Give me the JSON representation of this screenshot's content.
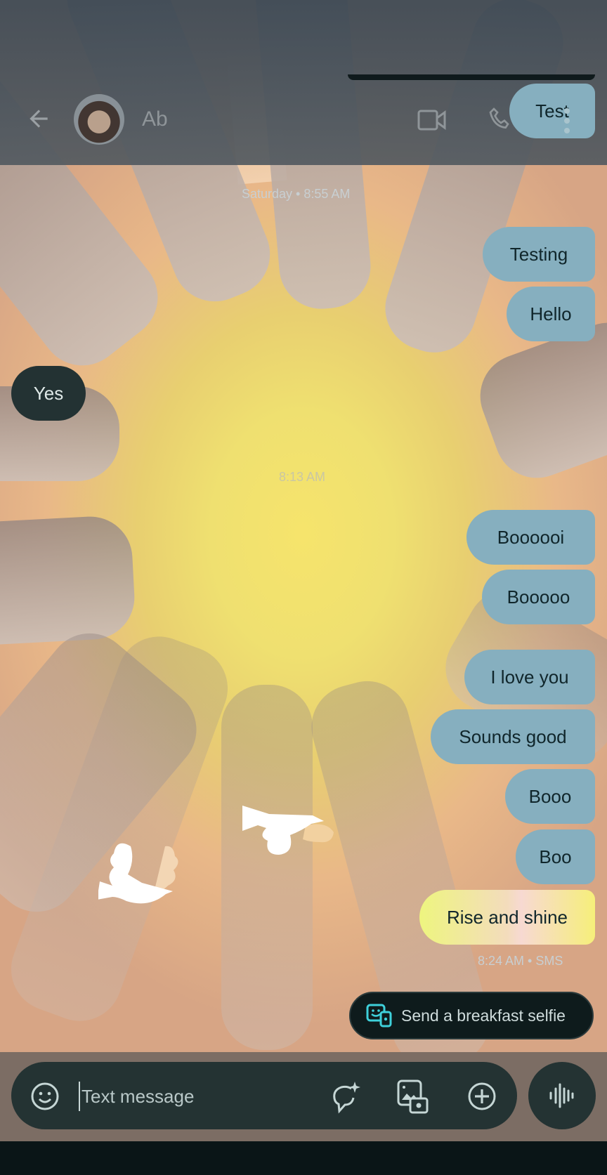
{
  "header": {
    "contact_name": "Ab",
    "back_icon": "arrow-left-icon",
    "video_icon": "video-call-icon",
    "phone_icon": "phone-icon",
    "more_icon": "more-vert-icon"
  },
  "conversation": {
    "date_divider": "Saturday • 8:55 AM",
    "time_divider": "8:13 AM",
    "messages": [
      {
        "text": "Test",
        "direction": "sent"
      },
      {
        "text": "Testing",
        "direction": "sent"
      },
      {
        "text": "Hello",
        "direction": "sent"
      },
      {
        "text": "Yes",
        "direction": "received"
      },
      {
        "text": "Boooooi",
        "direction": "sent"
      },
      {
        "text": "Booooo",
        "direction": "sent"
      },
      {
        "text": "I love you",
        "direction": "sent"
      },
      {
        "text": "Sounds good",
        "direction": "sent"
      },
      {
        "text": "Booo",
        "direction": "sent"
      },
      {
        "text": "Boo",
        "direction": "sent"
      },
      {
        "text": "Rise and shine",
        "direction": "sent",
        "effect": "sunrise"
      }
    ],
    "last_status": "8:24 AM • SMS"
  },
  "suggestion": {
    "label": "Send a breakfast selfie",
    "icon": "selfie-icon"
  },
  "composer": {
    "placeholder": "Text message",
    "value": "",
    "emoji_icon": "emoji-icon",
    "magic_compose_icon": "magic-compose-icon",
    "gallery_icon": "gallery-camera-icon",
    "add_icon": "add-circle-icon",
    "voice_icon": "voice-waveform-icon"
  },
  "colors": {
    "sent_bubble": "#86afbf",
    "received_bubble": "#233233",
    "accent": "#3ed0da"
  }
}
